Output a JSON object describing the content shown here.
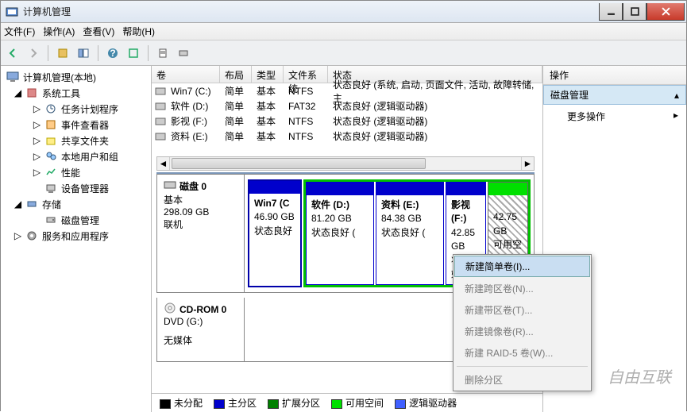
{
  "titlebar": {
    "title": "计算机管理"
  },
  "menu": {
    "file": "文件(F)",
    "action": "操作(A)",
    "view": "查看(V)",
    "help": "帮助(H)"
  },
  "tree": {
    "root": "计算机管理(本地)",
    "systools": "系统工具",
    "task": "任务计划程序",
    "event": "事件查看器",
    "shared": "共享文件夹",
    "users": "本地用户和组",
    "perf": "性能",
    "devmgr": "设备管理器",
    "storage": "存储",
    "diskmgmt": "磁盘管理",
    "services": "服务和应用程序"
  },
  "columns": {
    "vol": "卷",
    "lay": "布局",
    "typ": "类型",
    "fs": "文件系统",
    "st": "状态"
  },
  "volumes": [
    {
      "name": "Win7 (C:)",
      "layout": "简单",
      "type": "基本",
      "fs": "NTFS",
      "status": "状态良好 (系统, 启动, 页面文件, 活动, 故障转储, 主"
    },
    {
      "name": "软件 (D:)",
      "layout": "简单",
      "type": "基本",
      "fs": "FAT32",
      "status": "状态良好 (逻辑驱动器)"
    },
    {
      "name": "影视 (F:)",
      "layout": "简单",
      "type": "基本",
      "fs": "NTFS",
      "status": "状态良好 (逻辑驱动器)"
    },
    {
      "name": "资料 (E:)",
      "layout": "简单",
      "type": "基本",
      "fs": "NTFS",
      "status": "状态良好 (逻辑驱动器)"
    }
  ],
  "disk0": {
    "label": "磁盘 0",
    "basic": "基本",
    "size": "298.09 GB",
    "online": "联机",
    "parts": [
      {
        "name": "Win7  (C",
        "size": "46.90 GB",
        "status": "状态良好",
        "kind": "primary"
      },
      {
        "name": "软件  (D:)",
        "size": "81.20 GB",
        "status": "状态良好 (",
        "kind": "logical"
      },
      {
        "name": "资料  (E:)",
        "size": "84.38 GB",
        "status": "状态良好 (",
        "kind": "logical"
      },
      {
        "name": "影视  (F:)",
        "size": "42.85 GB",
        "status": "状态良好",
        "kind": "logical"
      },
      {
        "name": "",
        "size": "42.75 GB",
        "status": "可用空间",
        "kind": "free"
      }
    ]
  },
  "cdrom": {
    "label": "CD-ROM 0",
    "drive": "DVD (G:)",
    "nomedia": "无媒体"
  },
  "legend": {
    "unalloc": "未分配",
    "primary": "主分区",
    "ext": "扩展分区",
    "free": "可用空间",
    "logical": "逻辑驱动器"
  },
  "actions": {
    "header": "操作",
    "diskmgmt": "磁盘管理",
    "more": "更多操作"
  },
  "ctx": {
    "simple": "新建简单卷(I)...",
    "span": "新建跨区卷(N)...",
    "stripe": "新建带区卷(T)...",
    "mirror": "新建镜像卷(R)...",
    "raid5": "新建 RAID-5 卷(W)...",
    "delete": "删除分区"
  },
  "watermark": "自由互联"
}
